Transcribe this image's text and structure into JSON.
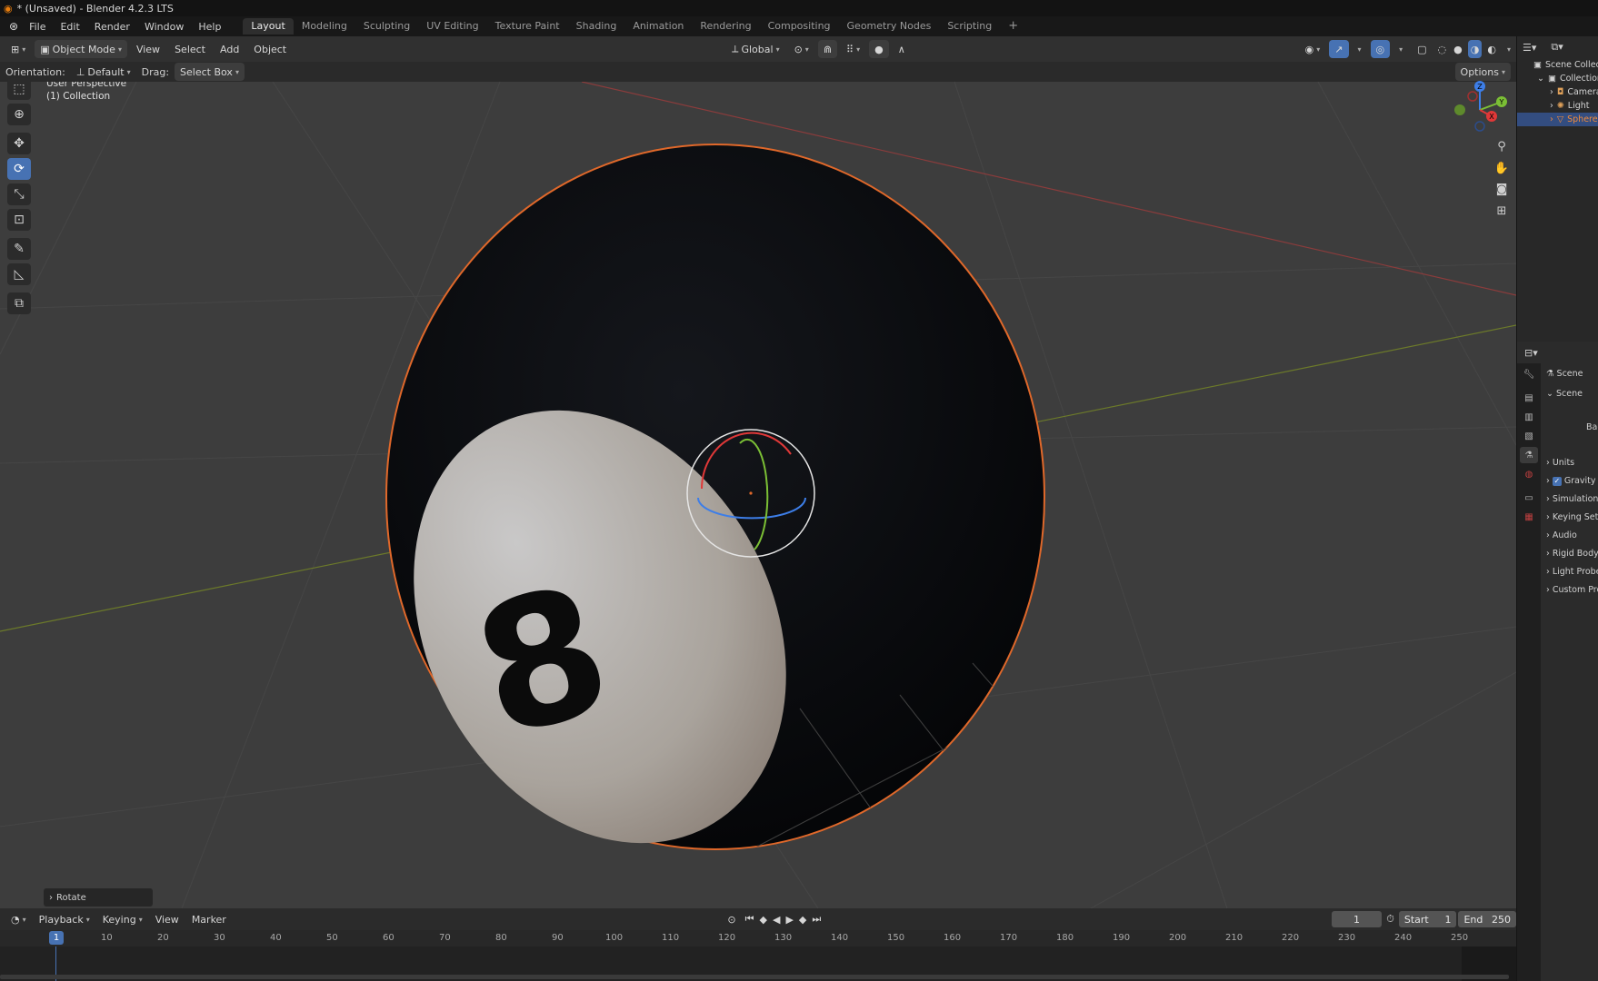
{
  "window": {
    "title": "* (Unsaved) - Blender 4.2.3 LTS"
  },
  "menu": {
    "items": [
      "File",
      "Edit",
      "Render",
      "Window",
      "Help"
    ]
  },
  "workspaces": {
    "tabs": [
      "Layout",
      "Modeling",
      "Sculpting",
      "UV Editing",
      "Texture Paint",
      "Shading",
      "Animation",
      "Rendering",
      "Compositing",
      "Geometry Nodes",
      "Scripting"
    ],
    "active": "Layout",
    "add": "+"
  },
  "viewport_header": {
    "mode": "Object Mode",
    "menus": [
      "View",
      "Select",
      "Add",
      "Object"
    ],
    "transform_orientation": "Global"
  },
  "tool_settings": {
    "orientation_label": "Orientation:",
    "orientation_value": "Default",
    "drag_label": "Drag:",
    "drag_value": "Select Box",
    "options": "Options"
  },
  "viewport": {
    "perspective": "User Perspective",
    "collection": "(1) Collection",
    "ball_number": "8",
    "axis_labels": {
      "x": "X",
      "y": "Y",
      "z": "Z"
    },
    "operator_panel": "Rotate"
  },
  "timeline": {
    "menus": [
      "Playback",
      "Keying",
      "View",
      "Marker"
    ],
    "current_frame": "1",
    "start_label": "Start",
    "start": "1",
    "end_label": "End",
    "end": "250",
    "ticks": [
      "10",
      "20",
      "30",
      "40",
      "50",
      "60",
      "70",
      "80",
      "90",
      "100",
      "110",
      "120",
      "130",
      "140",
      "150",
      "160",
      "170",
      "180",
      "190",
      "200",
      "210",
      "220",
      "230",
      "240",
      "250"
    ],
    "marker": "1"
  },
  "outliner": {
    "root": "Scene Collection",
    "collection": "Collection",
    "items": [
      {
        "name": "Camera",
        "selected": false
      },
      {
        "name": "Light",
        "selected": false
      },
      {
        "name": "Sphere",
        "selected": true
      }
    ]
  },
  "properties": {
    "context": "Scene",
    "panel": "Scene",
    "background_label": "Bac",
    "sections": [
      "Units",
      "Gravity",
      "Simulation",
      "Keying Sets",
      "Audio",
      "Rigid Body World",
      "Light Probes",
      "Custom Properties"
    ],
    "gravity_checked": true
  },
  "colors": {
    "accent": "#4772b3",
    "selection": "#e0682a",
    "grid": "#3d3d3d"
  }
}
